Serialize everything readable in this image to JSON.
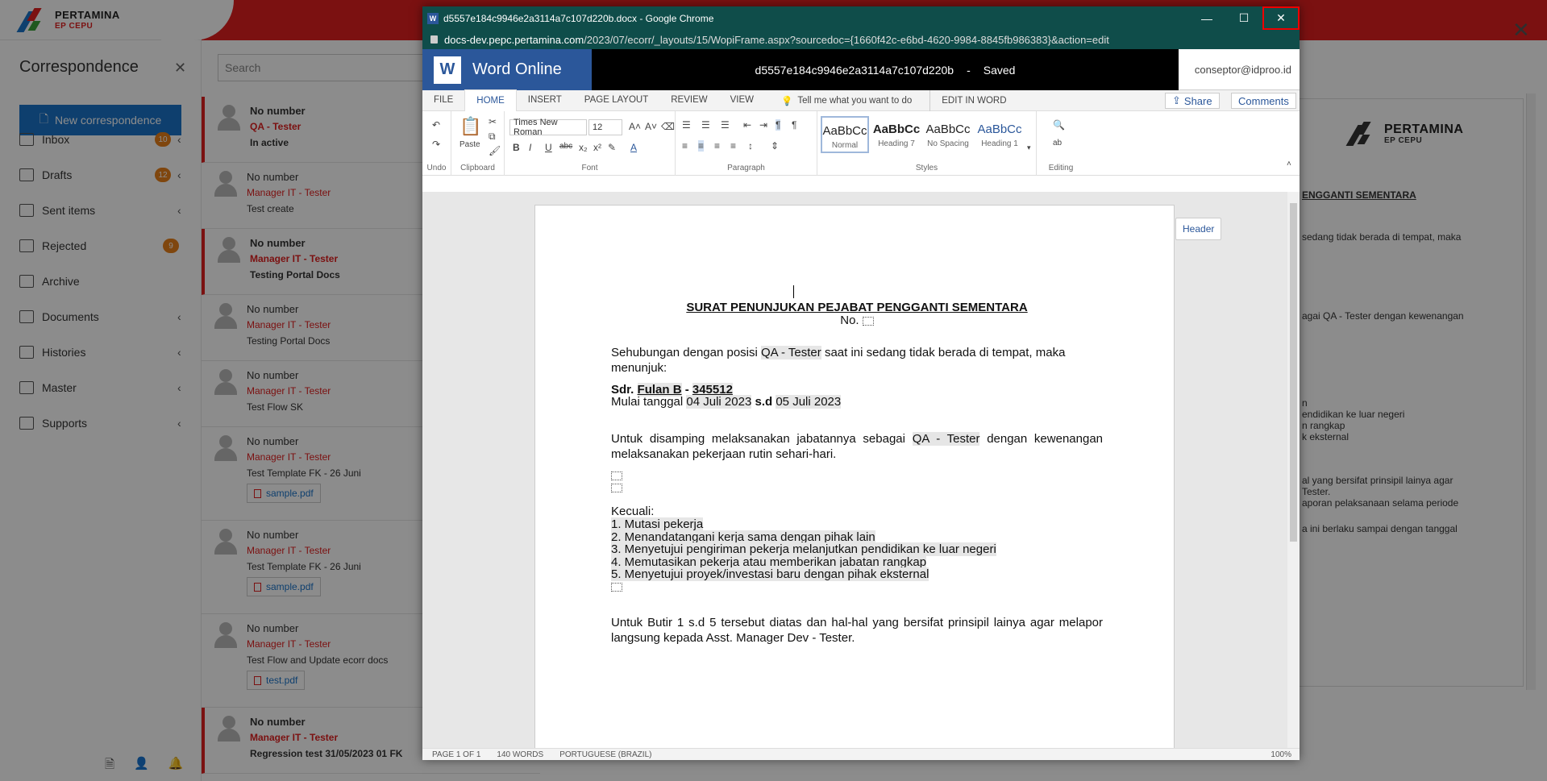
{
  "brand": {
    "name": "PERTAMINA",
    "sub": "EP CEPU"
  },
  "sidebar": {
    "title": "Correspondence",
    "new_button": "New correspondence",
    "items": [
      {
        "label": "Inbox",
        "badge": "10",
        "chevron": "‹"
      },
      {
        "label": "Drafts",
        "badge": "12",
        "chevron": "‹"
      },
      {
        "label": "Sent items",
        "badge": "",
        "chevron": "‹"
      },
      {
        "label": "Rejected",
        "badge": "9",
        "chevron": ""
      },
      {
        "label": "Archive",
        "badge": "",
        "chevron": ""
      },
      {
        "label": "Documents",
        "badge": "",
        "chevron": "‹"
      },
      {
        "label": "Histories",
        "badge": "",
        "chevron": "‹"
      },
      {
        "label": "Master",
        "badge": "",
        "chevron": "‹"
      },
      {
        "label": "Supports",
        "badge": "",
        "chevron": "‹"
      }
    ]
  },
  "list": {
    "search_placeholder": "Search",
    "messages": [
      {
        "number": "No number",
        "from": "QA - Tester",
        "subject": "In active",
        "attachment": ""
      },
      {
        "number": "No number",
        "from": "Manager IT - Tester",
        "subject": "Test create",
        "attachment": ""
      },
      {
        "number": "No number",
        "from": "Manager IT - Tester",
        "subject": "Testing Portal Docs",
        "attachment": ""
      },
      {
        "number": "No number",
        "from": "Manager IT - Tester",
        "subject": "Testing Portal Docs",
        "attachment": ""
      },
      {
        "number": "No number",
        "from": "Manager IT - Tester",
        "subject": "Test Flow SK",
        "attachment": ""
      },
      {
        "number": "No number",
        "from": "Manager IT - Tester",
        "subject": "Test Template FK - 26 Juni",
        "attachment": "sample.pdf"
      },
      {
        "number": "No number",
        "from": "Manager IT - Tester",
        "subject": "Test Template FK - 26 Juni",
        "attachment": "sample.pdf"
      },
      {
        "number": "No number",
        "from": "Manager IT - Tester",
        "subject": "Test Flow and Update ecorr docs",
        "attachment": "test.pdf"
      },
      {
        "number": "No number",
        "from": "Manager IT - Tester",
        "subject": "Regression test 31/05/2023 01 FK",
        "attachment": ""
      }
    ]
  },
  "preview": {
    "brand": "PERTAMINA",
    "brand_sub": "EP CEPU",
    "heading": "ENGGANTI SEMENTARA",
    "lines": [
      "sedang tidak berada di tempat, maka",
      "agai QA - Tester dengan kewenangan",
      "n",
      "endidikan ke luar negeri",
      "n rangkap",
      "k eksternal",
      "al yang bersifat prinsipil lainya agar",
      "Tester.",
      "aporan pelaksanaan selama periode",
      "a ini berlaku sampai dengan tanggal"
    ]
  },
  "chrome": {
    "title": "d5557e184c9946e2a3114a7c107d220b.docx - Google Chrome",
    "url_host": "docs-dev.pepc.pertamina.com",
    "url_path": "/2023/07/ecorr/_layouts/15/WopiFrame.aspx?sourcedoc={1660f42c-e6bd-4620-9984-8845fb986383}&action=edit"
  },
  "word": {
    "app_name": "Word Online",
    "doc_name": "d5557e184c9946e2a3114a7c107d220b",
    "sep": "-",
    "save_state": "Saved",
    "user": "conseptor@idproo.id",
    "tabs": [
      "FILE",
      "HOME",
      "INSERT",
      "PAGE LAYOUT",
      "REVIEW",
      "VIEW"
    ],
    "tell_me": "Tell me what you want to do",
    "edit_in_word": "EDIT IN WORD",
    "share": "Share",
    "comments": "Comments",
    "font_name": "Times New Roman",
    "font_size": "12",
    "groups": [
      "Undo",
      "Clipboard",
      "Font",
      "Paragraph",
      "Styles",
      "Editing"
    ],
    "paste_label": "Paste",
    "styles": [
      {
        "sample": "AaBbCc",
        "name": "Normal"
      },
      {
        "sample": "AaBbCc",
        "name": "Heading 7"
      },
      {
        "sample": "AaBbCc",
        "name": "No Spacing"
      },
      {
        "sample": "AaBbCc",
        "name": "Heading 1"
      }
    ],
    "header_tag": "Header",
    "status": {
      "page": "PAGE 1 OF 1",
      "words": "140 WORDS",
      "lang": "PORTUGUESE (BRAZIL)",
      "zoom": "100%"
    }
  },
  "document": {
    "title": "SURAT PENUNJUKAN PEJABAT PENGGANTI SEMENTARA",
    "number": "No.",
    "p1_a": "Sehubungan dengan posisi",
    "p1_role": "QA - Tester",
    "p1_b": "saat ini sedang tidak berada di tempat, maka menunjuk:",
    "sdr": "Sdr.",
    "person": "Fulan B",
    "dash": "-",
    "person_id": "345512",
    "start_a": "Mulai tanggal",
    "start_date": "04 Juli 2023",
    "sd": "s.d",
    "end_date": "05 Juli 2023",
    "p2_a": "Untuk disamping melaksanakan jabatannya sebagai",
    "p2_role": "QA - Tester",
    "p2_b": "dengan kewenangan melaksanakan pekerjaan rutin sehari-hari.",
    "except_label": "Kecuali:",
    "exceptions": [
      "1. Mutasi pekerja",
      "2. Menandatangani kerja sama dengan pihak lain",
      "3. Menyetujui pengiriman pekerja melanjutkan pendidikan ke luar negeri",
      "4. Memutasikan pekerja atau memberikan jabatan rangkap",
      "5. Menyetujui proyek/investasi baru dengan pihak eksternal"
    ],
    "p3": "Untuk Butir 1 s.d 5 tersebut diatas dan hal-hal yang bersifat prinsipil lainya agar melapor langsung kepada Asst. Manager Dev - Tester."
  }
}
